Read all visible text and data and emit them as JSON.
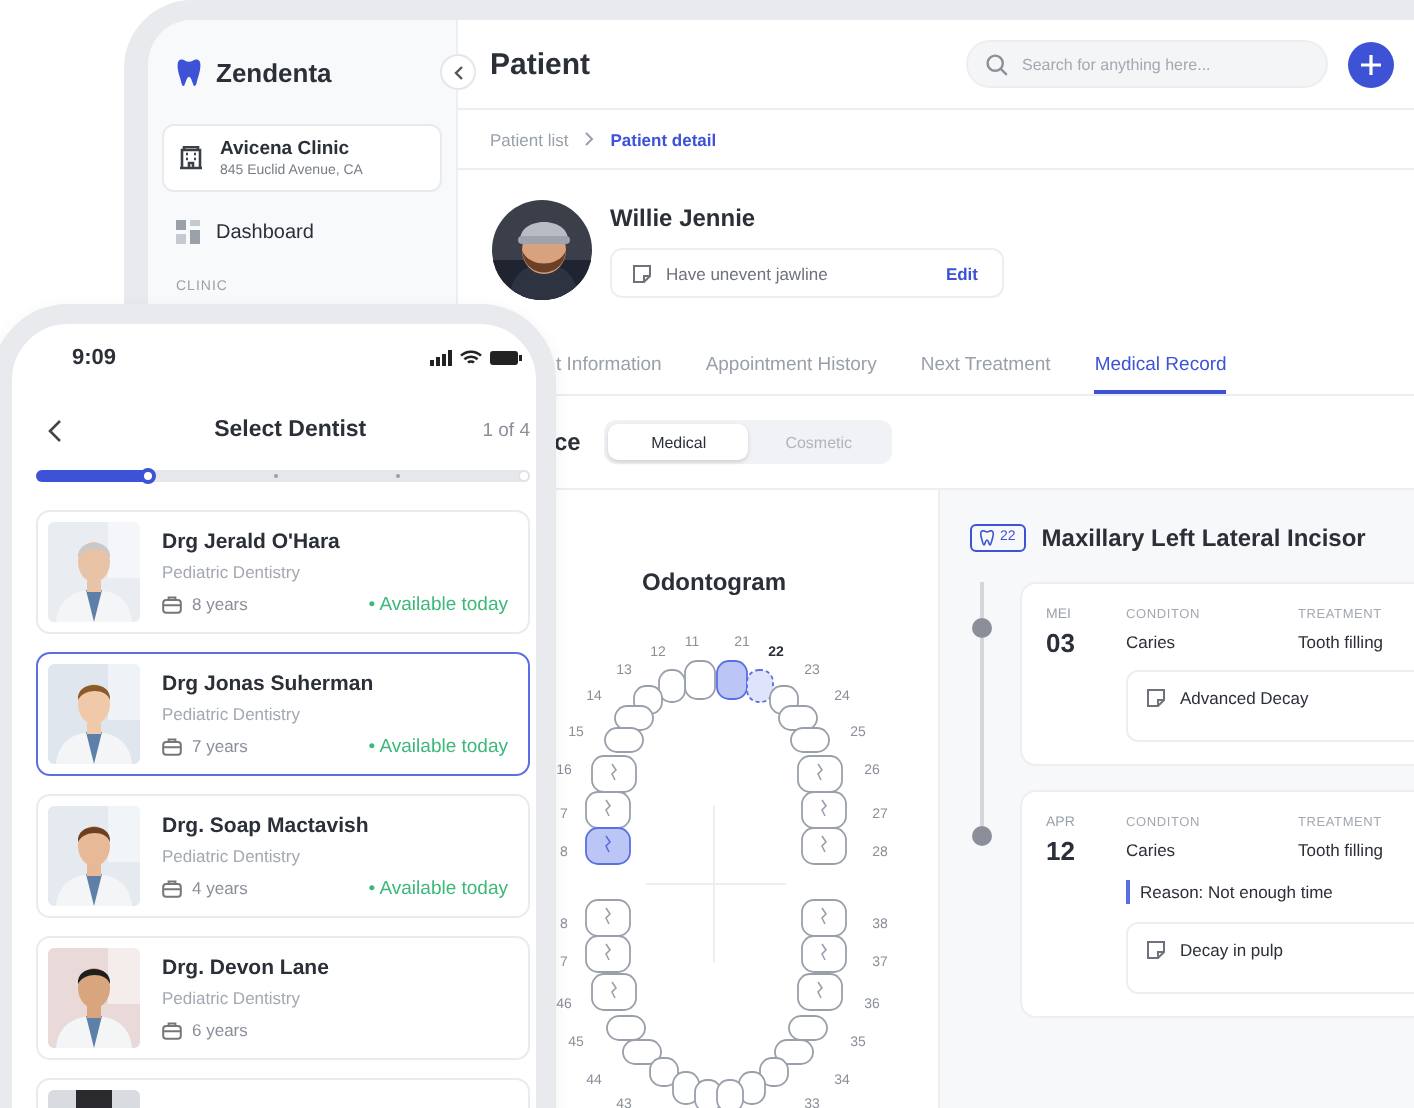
{
  "sidebar": {
    "brand": "Zendenta",
    "clinic": {
      "name": "Avicena Clinic",
      "address": "845 Euclid Avenue, CA"
    },
    "items": [
      {
        "label": "Dashboard",
        "selected": false
      }
    ],
    "section": "CLINIC"
  },
  "header": {
    "title": "Patient",
    "search": {
      "placeholder": "Search for anything here..."
    }
  },
  "breadcrumb": [
    {
      "label": "Patient list",
      "current": false
    },
    {
      "label": "Patient detail",
      "current": true
    }
  ],
  "patient": {
    "name": "Willie Jennie",
    "note": "Have unevent jawline",
    "edit": "Edit"
  },
  "tabs": [
    {
      "label": "t Information",
      "selected": false
    },
    {
      "label": "Appointment History",
      "selected": false
    },
    {
      "label": "Next Treatment",
      "selected": false
    },
    {
      "label": "Medical Record",
      "selected": true
    }
  ],
  "record": {
    "heading": "ce",
    "segments": [
      {
        "label": "Medical",
        "selected": true
      },
      {
        "label": "Cosmetic",
        "selected": false
      }
    ]
  },
  "odontogram": {
    "title": "Odontogram",
    "upper_right": [
      {
        "label": "11",
        "marked": false,
        "current": false
      },
      {
        "label": "12",
        "marked": false,
        "current": false
      },
      {
        "label": "13",
        "marked": false,
        "current": false
      },
      {
        "label": "14",
        "marked": false,
        "current": false
      },
      {
        "label": "15",
        "marked": false,
        "current": false
      },
      {
        "label": "16",
        "marked": false,
        "current": false
      },
      {
        "label": "7",
        "marked": false,
        "current": false
      },
      {
        "label": "8",
        "marked": true,
        "current": false
      }
    ],
    "upper_left": [
      {
        "label": "21",
        "marked": true,
        "current": false
      },
      {
        "label": "22",
        "marked": false,
        "current": true
      },
      {
        "label": "23",
        "marked": false,
        "current": false
      },
      {
        "label": "24",
        "marked": false,
        "current": false
      },
      {
        "label": "25",
        "marked": false,
        "current": false
      },
      {
        "label": "26",
        "marked": false,
        "current": false
      },
      {
        "label": "27",
        "marked": false,
        "current": false
      },
      {
        "label": "28",
        "marked": false,
        "current": false
      }
    ],
    "lower_right": [
      {
        "label": "8",
        "marked": false,
        "current": false
      },
      {
        "label": "7",
        "marked": false,
        "current": false
      },
      {
        "label": "46",
        "marked": false,
        "current": false
      },
      {
        "label": "45",
        "marked": false,
        "current": false
      },
      {
        "label": "44",
        "marked": false,
        "current": false
      },
      {
        "label": "43",
        "marked": false,
        "current": false
      },
      {
        "marked": false,
        "current": false
      },
      {
        "marked": false,
        "current": false
      }
    ],
    "lower_left": [
      {
        "label": "38",
        "marked": false,
        "current": false
      },
      {
        "label": "37",
        "marked": false,
        "current": false
      },
      {
        "label": "36",
        "marked": false,
        "current": false
      },
      {
        "label": "35",
        "marked": false,
        "current": false
      },
      {
        "label": "34",
        "marked": false,
        "current": false
      },
      {
        "label": "33",
        "marked": false,
        "current": false
      },
      {
        "marked": false,
        "current": false
      },
      {
        "marked": false,
        "current": false
      }
    ]
  },
  "tooth_detail": {
    "number": "22",
    "name": "Maxillary Left Lateral Incisor",
    "entries": [
      {
        "month": "MEI",
        "day": "03",
        "condition_label": "CONDITON",
        "condition": "Caries",
        "treatment_label": "TREATMENT",
        "treatment": "Tooth filling",
        "note": "Advanced Decay"
      },
      {
        "month": "APR",
        "day": "12",
        "condition_label": "CONDITON",
        "condition": "Caries",
        "treatment_label": "TREATMENT",
        "treatment": "Tooth filling",
        "reason": "Reason: Not enough time",
        "note": "Decay in pulp"
      }
    ]
  },
  "phone": {
    "time": "9:09",
    "title": "Select Dentist",
    "step": "1 of 4",
    "progress": {
      "level": 0.24
    },
    "dentists": [
      {
        "name": "Drg Jerald O'Hara",
        "specialty": "Pediatric Dentistry",
        "experience": "8 years",
        "availability": "• Available today",
        "selected": false
      },
      {
        "name": "Drg Jonas Suherman",
        "specialty": "Pediatric Dentistry",
        "experience": "7 years",
        "availability": "• Available today",
        "selected": true
      },
      {
        "name": "Drg. Soap Mactavish",
        "specialty": "Pediatric Dentistry",
        "experience": "4 years",
        "availability": "• Available today",
        "selected": false
      },
      {
        "name": "Drg. Devon Lane",
        "specialty": "Pediatric Dentistry",
        "experience": "6 years",
        "selected": false
      }
    ]
  }
}
